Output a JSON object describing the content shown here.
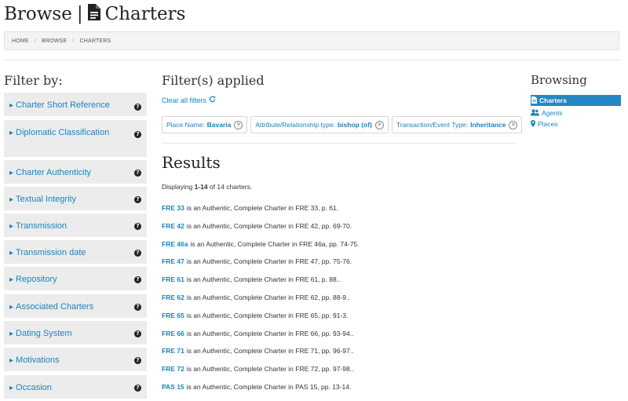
{
  "header": {
    "browse": "Browse",
    "separator": "|",
    "charters": "Charters"
  },
  "breadcrumb": [
    "HOME",
    "BROWSE",
    "CHARTERS"
  ],
  "filter_by": {
    "title": "Filter by:",
    "items": [
      "Charter Short Reference",
      "Diplomatic Classification",
      "Charter Authenticity",
      "Textual Integrity",
      "Transmission",
      "Transmission date",
      "Repository",
      "Associated Charters",
      "Dating System",
      "Motivations",
      "Occasion"
    ],
    "help_icon": "?"
  },
  "filters_applied": {
    "title": "Filter(s) applied",
    "clear_all": "Clear all filters",
    "chips": [
      {
        "label": "Place Name:",
        "value": "Bavaria"
      },
      {
        "label": "Attribute/Relationship type:",
        "value": "bishop (of)"
      },
      {
        "label": "Transaction/Event Type:",
        "value": "Inheritance"
      }
    ]
  },
  "results": {
    "title": "Results",
    "displaying_prefix": "Displaying",
    "displaying_range": "1-14",
    "displaying_suffix": "of 14 charters.",
    "rows": [
      {
        "ref": "FRE 33",
        "text": "is an Authentic, Complete Charter in FRE 33, p. 61."
      },
      {
        "ref": "FRE 42",
        "text": "is an Authentic, Complete Charter in FRE 42, pp. 69-70."
      },
      {
        "ref": "FRE 46a",
        "text": "is an Authentic, Complete Charter in FRE 46a, pp. 74-75."
      },
      {
        "ref": "FRE 47",
        "text": "is an Authentic, Complete Charter in FRE 47, pp. 75-76."
      },
      {
        "ref": "FRE 61",
        "text": "is an Authentic, Complete Charter in FRE 61, p. 88.."
      },
      {
        "ref": "FRE 62",
        "text": "is an Authentic, Complete Charter in FRE 62, pp. 88-9.."
      },
      {
        "ref": "FRE 65",
        "text": "is an Authentic, Complete Charter in FRE 65, pp. 91-3."
      },
      {
        "ref": "FRE 66",
        "text": "is an Authentic, Complete Charter in FRE 66, pp. 93-94.."
      },
      {
        "ref": "FRE 71",
        "text": "is an Authentic, Complete Charter in FRE 71, pp. 96-97.."
      },
      {
        "ref": "FRE 72",
        "text": "is an Authentic, Complete Charter in FRE 72, pp. 97-98.."
      },
      {
        "ref": "PAS 15",
        "text": "is an Authentic, Complete Charter in PAS 15, pp. 13-14."
      }
    ]
  },
  "browsing": {
    "title": "Browsing",
    "items": [
      {
        "label": "Charters",
        "icon": "document-icon",
        "active": true
      },
      {
        "label": "Agents",
        "icon": "users-icon",
        "active": false
      },
      {
        "label": "Places",
        "icon": "map-marker-icon",
        "active": false
      }
    ]
  },
  "colors": {
    "link": "#1a84be",
    "active_bg": "#2387c4",
    "filter_bg": "#ececec"
  }
}
